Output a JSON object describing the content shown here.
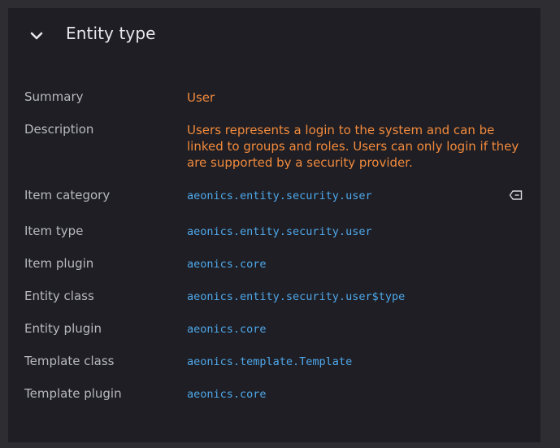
{
  "panel": {
    "title": "Entity type",
    "toggle_icon": "chevron-down-icon"
  },
  "rows": [
    {
      "label": "Summary",
      "value": "User"
    },
    {
      "label": "Description",
      "value": "Users represents a login to the system and can be linked to groups and roles. Users can only login if they are supported by a security provider."
    },
    {
      "label": "Item category",
      "value": "aeonics.entity.security.user",
      "action_icon": "tag-clear-icon"
    },
    {
      "label": "Item type",
      "value": "aeonics.entity.security.user"
    },
    {
      "label": "Item plugin",
      "value": "aeonics.core"
    },
    {
      "label": "Entity class",
      "value": "aeonics.entity.security.user$type"
    },
    {
      "label": "Entity plugin",
      "value": "aeonics.core"
    },
    {
      "label": "Template class",
      "value": "aeonics.template.Template"
    },
    {
      "label": "Template plugin",
      "value": "aeonics.core"
    }
  ],
  "colors": {
    "background": "#2d2d32",
    "panel": "#1e1e24",
    "label": "#b8b8c0",
    "accent_orange": "#f28a3c",
    "accent_blue": "#4fa8ea"
  }
}
